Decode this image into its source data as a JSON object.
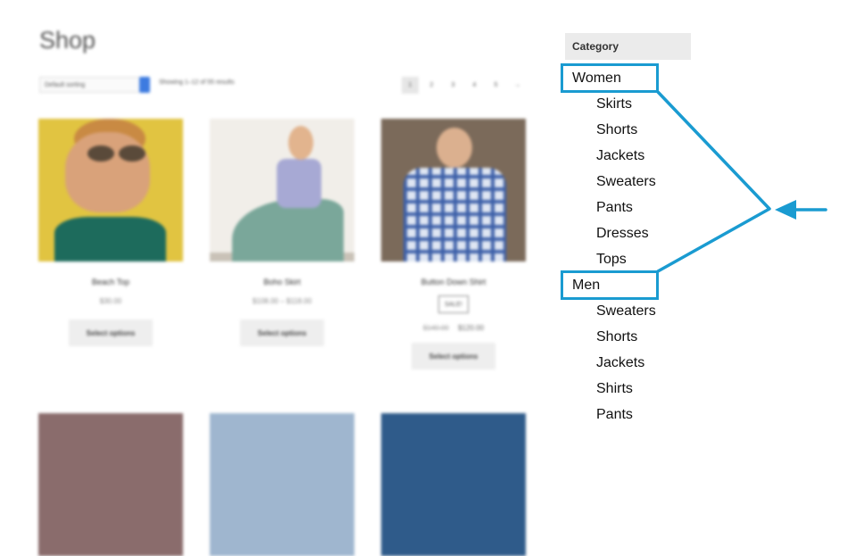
{
  "shop": {
    "title": "Shop",
    "sorting": "Default sorting",
    "result_count": "Showing 1–12 of 55 results",
    "pages": [
      "1",
      "2",
      "3",
      "4",
      "5",
      "→"
    ]
  },
  "products": [
    {
      "name": "Beach Top",
      "price": "$30.00",
      "button": "Select options"
    },
    {
      "name": "Boho Skirt",
      "price": "$108.00 – $118.00",
      "button": "Select options"
    },
    {
      "name": "Button Down Shirt",
      "badge": "SALE!",
      "old_price": "$140.00",
      "price": "$120.00",
      "button": "Select options"
    }
  ],
  "sidebar": {
    "header": "Category",
    "women": {
      "label": "Women",
      "items": [
        "Skirts",
        "Shorts",
        "Jackets",
        "Sweaters",
        "Pants",
        "Dresses",
        "Tops"
      ]
    },
    "men": {
      "label": "Men",
      "items": [
        "Sweaters",
        "Shorts",
        "Jackets",
        "Shirts",
        "Pants"
      ]
    }
  },
  "colors": {
    "annotation": "#1a9bd1",
    "category_header_bg": "#ebebeb"
  }
}
